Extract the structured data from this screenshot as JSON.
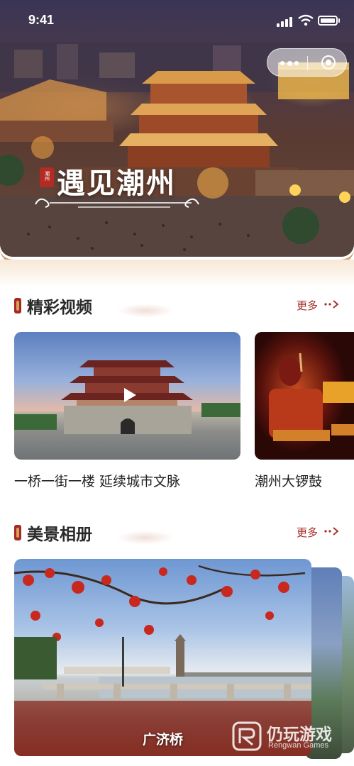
{
  "status_bar": {
    "time": "9:41"
  },
  "hero": {
    "seal_text": "潮州",
    "title": "遇见潮州"
  },
  "sections": {
    "videos": {
      "title": "精彩视频",
      "more_label": "更多"
    },
    "gallery": {
      "title": "美景相册",
      "more_label": "更多"
    }
  },
  "videos": [
    {
      "caption": "一桥一街一楼 延续城市文脉"
    },
    {
      "caption": "潮州大锣鼓"
    }
  ],
  "gallery": {
    "caption": "广济桥"
  },
  "watermark": {
    "name": "仍玩游戏",
    "sub": "Rengwan Games"
  },
  "colors": {
    "accent": "#a52a22",
    "gold": "#c9a279"
  },
  "icons": {
    "capsule_more": "more-dots-icon",
    "capsule_close": "close-target-icon",
    "play": "play-icon",
    "more_arrow": "dots-chevron-icon"
  }
}
